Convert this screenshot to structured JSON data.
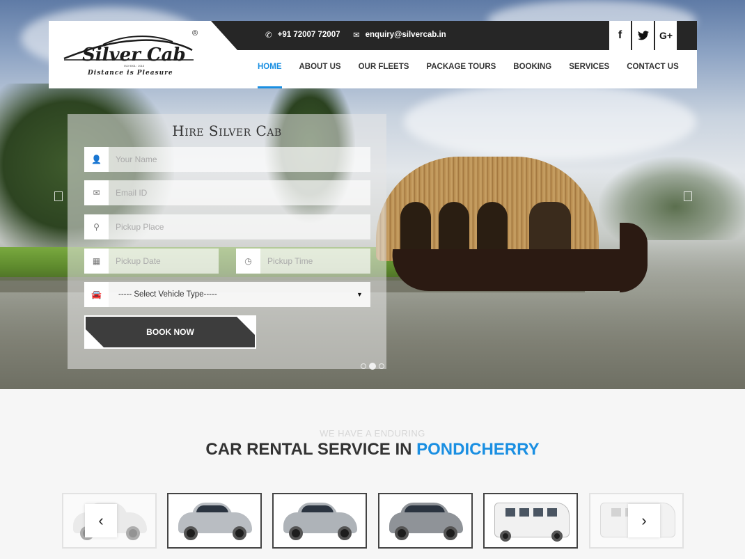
{
  "brand": {
    "name": "Silver Cab",
    "tagline": "Distance is Pleasure",
    "iso": "ISO 9001 : 2015",
    "reg": "®"
  },
  "topbar": {
    "phone": "+91 72007 72007",
    "email": "enquiry@silvercab.in",
    "social": [
      {
        "icon": "facebook-icon",
        "glyph": "f"
      },
      {
        "icon": "twitter-icon",
        "glyph": "🐦"
      },
      {
        "icon": "google-plus-icon",
        "glyph": "G+"
      }
    ]
  },
  "nav": {
    "items": [
      "HOME",
      "ABOUT US",
      "OUR FLEETS",
      "PACKAGE TOURS",
      "BOOKING",
      "SERVICES",
      "CONTACT US"
    ],
    "active": "HOME"
  },
  "form": {
    "title": "Hire Silver Cab",
    "name_placeholder": "Your Name",
    "email_placeholder": "Email ID",
    "pickup_place_placeholder": "Pickup Place",
    "pickup_date_placeholder": "Pickup Date",
    "pickup_time_placeholder": "Pickup Time",
    "vehicle_type_selected": "----- Select Vehicle Type-----",
    "book_label": "BOOK NOW"
  },
  "slider": {
    "dot_count": 3,
    "active_dot": 2
  },
  "section": {
    "subtitle": "WE HAVE A ENDURING",
    "title_prefix": "CAR RENTAL SERVICE IN ",
    "title_highlight": "PONDICHERRY"
  },
  "colors": {
    "accent": "#1a8fe2",
    "dark": "#262626",
    "button": "#3d3d3d"
  }
}
